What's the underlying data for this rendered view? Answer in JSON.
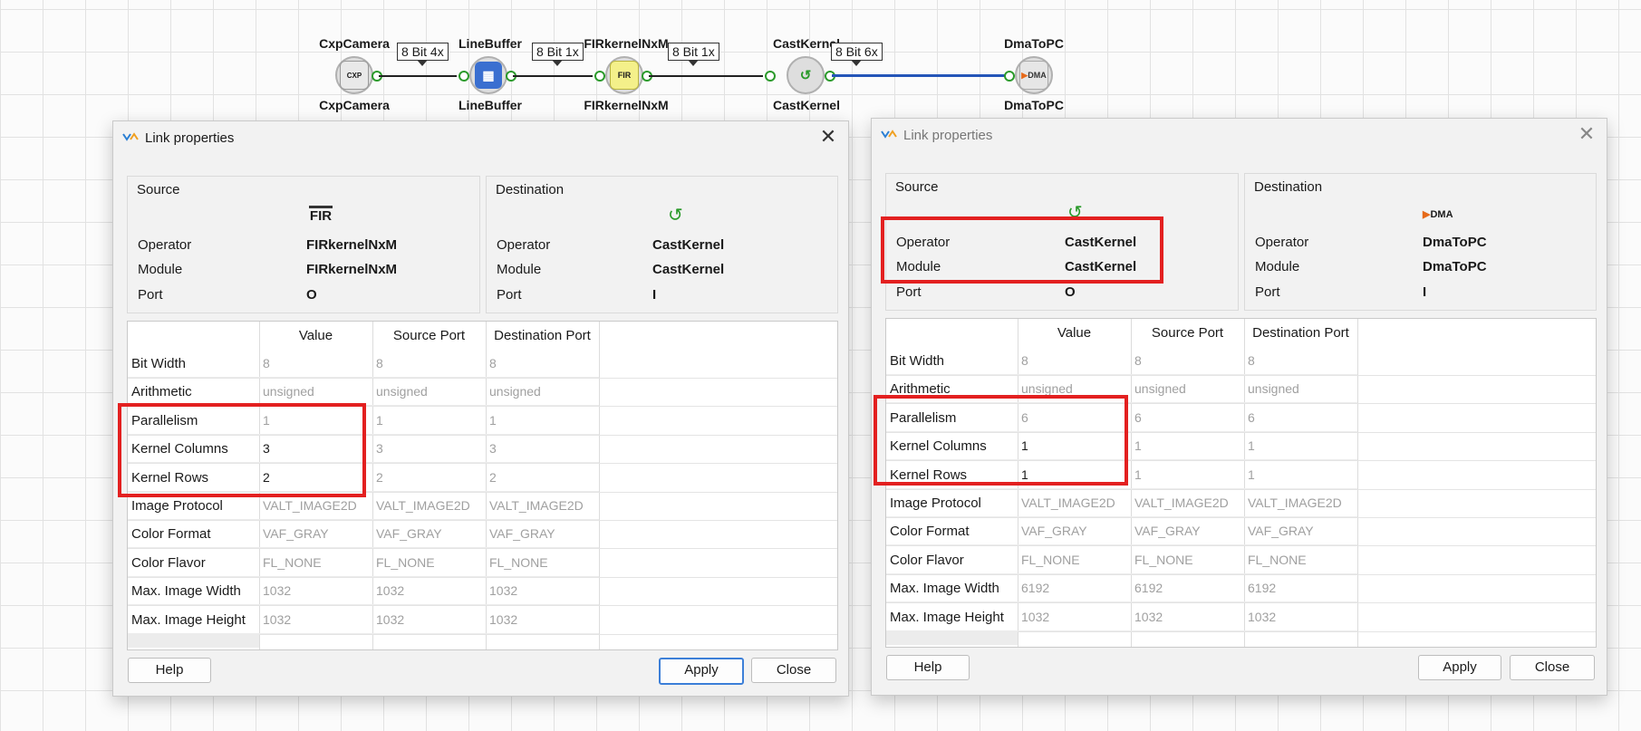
{
  "pipeline": {
    "operators": [
      {
        "top_label": "CxpCamera",
        "bottom_label": "CxpCamera",
        "icon": "camera-icon",
        "badge": "CXP"
      },
      {
        "top_label": "LineBuffer",
        "bottom_label": "LineBuffer",
        "icon": "linebuffer-icon",
        "badge": ""
      },
      {
        "top_label": "FIRkernelNxM",
        "bottom_label": "FIRkernelNxM",
        "icon": "fir-icon",
        "badge": "FIR"
      },
      {
        "top_label": "CastKernel",
        "bottom_label": "CastKernel",
        "icon": "castkernel-icon",
        "badge": ""
      },
      {
        "top_label": "DmaToPC",
        "bottom_label": "DmaToPC",
        "icon": "dma-icon",
        "badge": "DMA"
      }
    ],
    "links": [
      "8 Bit 4x",
      "8 Bit 1x",
      "8 Bit 1x",
      "8 Bit 6x"
    ]
  },
  "dialogs": [
    {
      "title": "Link properties",
      "source": {
        "group_title": "Source",
        "icon_text": "FIR",
        "operator_label": "Operator",
        "operator": "FIRkernelNxM",
        "module_label": "Module",
        "module": "FIRkernelNxM",
        "port_label": "Port",
        "port": "O"
      },
      "destination": {
        "group_title": "Destination",
        "operator_label": "Operator",
        "operator": "CastKernel",
        "module_label": "Module",
        "module": "CastKernel",
        "port_label": "Port",
        "port": "I"
      },
      "columns": [
        "Value",
        "Source Port",
        "Destination Port"
      ],
      "rows": [
        {
          "label": "Bit Width",
          "value": "8",
          "src": "8",
          "dst": "8",
          "editable": false
        },
        {
          "label": "Arithmetic",
          "value": "unsigned",
          "src": "unsigned",
          "dst": "unsigned",
          "editable": false
        },
        {
          "label": "Parallelism",
          "value": "1",
          "src": "1",
          "dst": "1",
          "editable": false
        },
        {
          "label": "Kernel Columns",
          "value": "3",
          "src": "3",
          "dst": "3",
          "editable": true
        },
        {
          "label": "Kernel Rows",
          "value": "2",
          "src": "2",
          "dst": "2",
          "editable": true
        },
        {
          "label": "Image Protocol",
          "value": "VALT_IMAGE2D",
          "src": "VALT_IMAGE2D",
          "dst": "VALT_IMAGE2D",
          "editable": false
        },
        {
          "label": "Color Format",
          "value": "VAF_GRAY",
          "src": "VAF_GRAY",
          "dst": "VAF_GRAY",
          "editable": false
        },
        {
          "label": "Color Flavor",
          "value": "FL_NONE",
          "src": "FL_NONE",
          "dst": "FL_NONE",
          "editable": false
        },
        {
          "label": "Max. Image Width",
          "value": "1032",
          "src": "1032",
          "dst": "1032",
          "editable": false
        },
        {
          "label": "Max. Image Height",
          "value": "1032",
          "src": "1032",
          "dst": "1032",
          "editable": false
        }
      ],
      "buttons": {
        "help": "Help",
        "apply": "Apply",
        "close": "Close"
      }
    },
    {
      "title": "Link properties",
      "source": {
        "group_title": "Source",
        "operator_label": "Operator",
        "operator": "CastKernel",
        "module_label": "Module",
        "module": "CastKernel",
        "port_label": "Port",
        "port": "O"
      },
      "destination": {
        "group_title": "Destination",
        "icon_text": "DMA",
        "operator_label": "Operator",
        "operator": "DmaToPC",
        "module_label": "Module",
        "module": "DmaToPC",
        "port_label": "Port",
        "port": "I"
      },
      "columns": [
        "Value",
        "Source Port",
        "Destination Port"
      ],
      "rows": [
        {
          "label": "Bit Width",
          "value": "8",
          "src": "8",
          "dst": "8",
          "editable": false
        },
        {
          "label": "Arithmetic",
          "value": "unsigned",
          "src": "unsigned",
          "dst": "unsigned",
          "editable": false
        },
        {
          "label": "Parallelism",
          "value": "6",
          "src": "6",
          "dst": "6",
          "editable": false
        },
        {
          "label": "Kernel Columns",
          "value": "1",
          "src": "1",
          "dst": "1",
          "editable": true
        },
        {
          "label": "Kernel Rows",
          "value": "1",
          "src": "1",
          "dst": "1",
          "editable": true
        },
        {
          "label": "Image Protocol",
          "value": "VALT_IMAGE2D",
          "src": "VALT_IMAGE2D",
          "dst": "VALT_IMAGE2D",
          "editable": false
        },
        {
          "label": "Color Format",
          "value": "VAF_GRAY",
          "src": "VAF_GRAY",
          "dst": "VAF_GRAY",
          "editable": false
        },
        {
          "label": "Color Flavor",
          "value": "FL_NONE",
          "src": "FL_NONE",
          "dst": "FL_NONE",
          "editable": false
        },
        {
          "label": "Max. Image Width",
          "value": "6192",
          "src": "6192",
          "dst": "6192",
          "editable": false
        },
        {
          "label": "Max. Image Height",
          "value": "1032",
          "src": "1032",
          "dst": "1032",
          "editable": false
        }
      ],
      "buttons": {
        "help": "Help",
        "apply": "Apply",
        "close": "Close"
      }
    }
  ],
  "colors": {
    "highlight": "#e32020",
    "port": "#2b9a2b",
    "selected_link": "#2455b8",
    "fir_icon": "#f4f08a",
    "linebuffer_icon": "#3a6fd0"
  }
}
